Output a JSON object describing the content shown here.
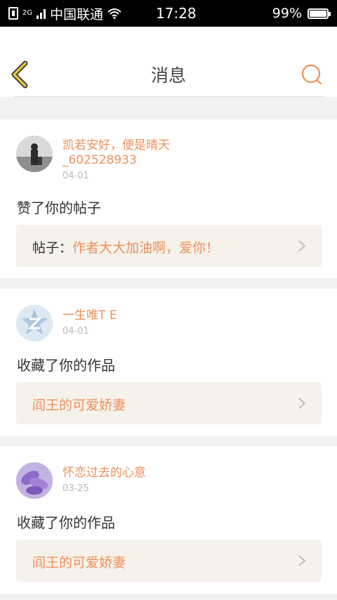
{
  "status_bar": {
    "network_type": "2G",
    "carrier": "中国联通",
    "time": "17:28",
    "battery": "99%",
    "battery_level": 0.99
  },
  "header": {
    "title": "消息",
    "back_icon": "chevron-left-icon",
    "search_icon": "search-icon"
  },
  "colors": {
    "accent": "#ef8f5a",
    "back_icon": "#e8c33a",
    "link_bg": "#f4f2ea"
  },
  "messages": [
    {
      "user": "凯若安好，便是晴天_602528933",
      "date": "04-01",
      "action": "赞了你的帖子",
      "link_prefix": "帖子：",
      "link_title": "作者大大加油啊，爱你！"
    },
    {
      "user": "一生唯T E",
      "date": "04-01",
      "action": "收藏了你的作品",
      "link_prefix": "",
      "link_title": "阎王的可爱娇妻"
    },
    {
      "user": "怀恋过去的心意",
      "date": "03-25",
      "action": "收藏了你的作品",
      "link_prefix": "",
      "link_title": "阎王的可爱娇妻"
    }
  ]
}
